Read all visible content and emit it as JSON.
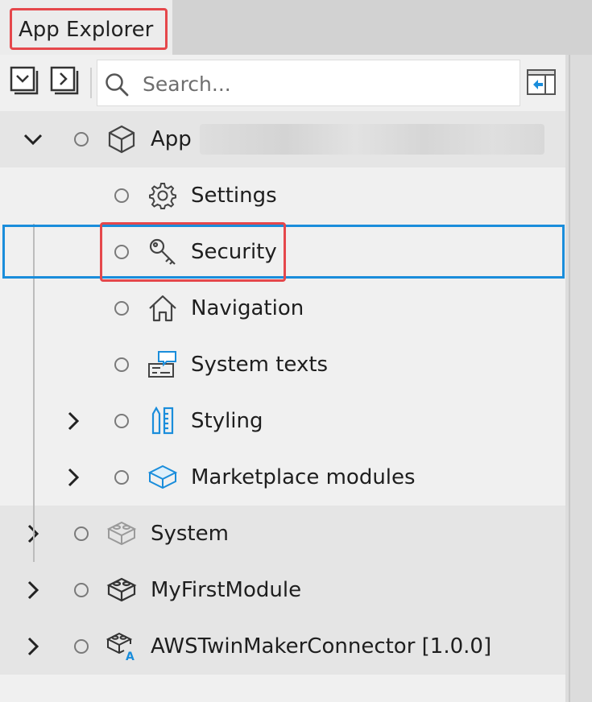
{
  "tab": {
    "title": "App Explorer"
  },
  "toolbar": {
    "expand_all_icon": "expand-all-icon",
    "collapse_icon": "collapse-all-icon",
    "search_placeholder": "Search...",
    "sidebar_icon": "dock-panel-icon"
  },
  "tree": {
    "app": {
      "label": "App",
      "icon": "cube-icon",
      "expanded": true
    },
    "app_children": [
      {
        "label": "Settings",
        "icon": "gear-icon",
        "selected": true
      },
      {
        "label": "Security",
        "icon": "key-icon"
      },
      {
        "label": "Navigation",
        "icon": "home-icon"
      },
      {
        "label": "System texts",
        "icon": "system-texts-icon"
      },
      {
        "label": "Styling",
        "icon": "styling-icon",
        "expandable": true
      },
      {
        "label": "Marketplace modules",
        "icon": "module-icon",
        "expandable": true
      }
    ],
    "modules": [
      {
        "label": "System",
        "icon": "module-gray-icon"
      },
      {
        "label": "MyFirstModule",
        "icon": "module-dark-icon"
      },
      {
        "label": "AWSTwinMakerConnector [1.0.0]",
        "icon": "module-addon-icon"
      }
    ]
  },
  "colors": {
    "selection_border": "#1a8ddb",
    "highlight_border": "#e5474b",
    "accent_icon": "#1a8ddb"
  }
}
